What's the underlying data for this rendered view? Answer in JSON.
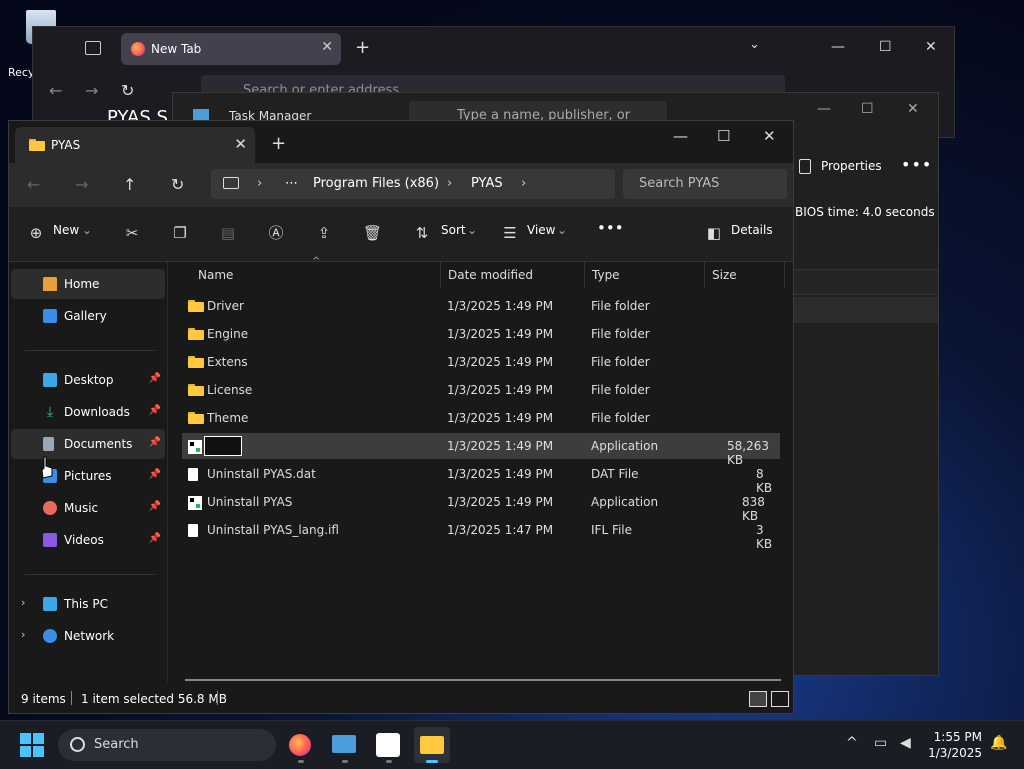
{
  "desktop": {
    "recycle_label": "Recy"
  },
  "browser": {
    "tab_title": "New Tab",
    "address_placeholder": "Search or enter address",
    "page_heading": "PYAS S"
  },
  "taskmgr": {
    "title": "Task Manager",
    "search_placeholder": "Type a name, publisher, or PID...",
    "properties_label": "Properties",
    "bios_time": "BIOS time:  4.0 seconds"
  },
  "explorer": {
    "tab_title": "PYAS",
    "breadcrumb": [
      "Program Files (x86)",
      "PYAS"
    ],
    "search_placeholder": "Search PYAS",
    "commands": {
      "new": "New",
      "sort": "Sort",
      "view": "View",
      "details": "Details"
    },
    "sidebar": {
      "home": "Home",
      "gallery": "Gallery",
      "desktop": "Desktop",
      "downloads": "Downloads",
      "documents": "Documents",
      "pictures": "Pictures",
      "music": "Music",
      "videos": "Videos",
      "this_pc": "This PC",
      "network": "Network"
    },
    "columns": {
      "name": "Name",
      "date": "Date modified",
      "type": "Type",
      "size": "Size"
    },
    "files": [
      {
        "name": "Driver",
        "date": "1/3/2025 1:49 PM",
        "type": "File folder",
        "size": ""
      },
      {
        "name": "Engine",
        "date": "1/3/2025 1:49 PM",
        "type": "File folder",
        "size": ""
      },
      {
        "name": "Extens",
        "date": "1/3/2025 1:49 PM",
        "type": "File folder",
        "size": ""
      },
      {
        "name": "License",
        "date": "1/3/2025 1:49 PM",
        "type": "File folder",
        "size": ""
      },
      {
        "name": "Theme",
        "date": "1/3/2025 1:49 PM",
        "type": "File folder",
        "size": ""
      },
      {
        "name": "",
        "date": "1/3/2025 1:49 PM",
        "type": "Application",
        "size": "58,263 KB"
      },
      {
        "name": "Uninstall PYAS.dat",
        "date": "1/3/2025 1:49 PM",
        "type": "DAT File",
        "size": "8 KB"
      },
      {
        "name": "Uninstall PYAS",
        "date": "1/3/2025 1:49 PM",
        "type": "Application",
        "size": "838 KB"
      },
      {
        "name": "Uninstall PYAS_lang.ifl",
        "date": "1/3/2025 1:47 PM",
        "type": "IFL File",
        "size": "3 KB"
      }
    ],
    "status": {
      "items": "9 items",
      "selected": "1 item selected  56.8 MB"
    }
  },
  "taskbar": {
    "search_label": "Search",
    "time": "1:55 PM",
    "date": "1/3/2025"
  },
  "colors": {
    "accent": "#4cc2ff",
    "folder": "#ffc83d",
    "selection": "#3d3d3d"
  }
}
